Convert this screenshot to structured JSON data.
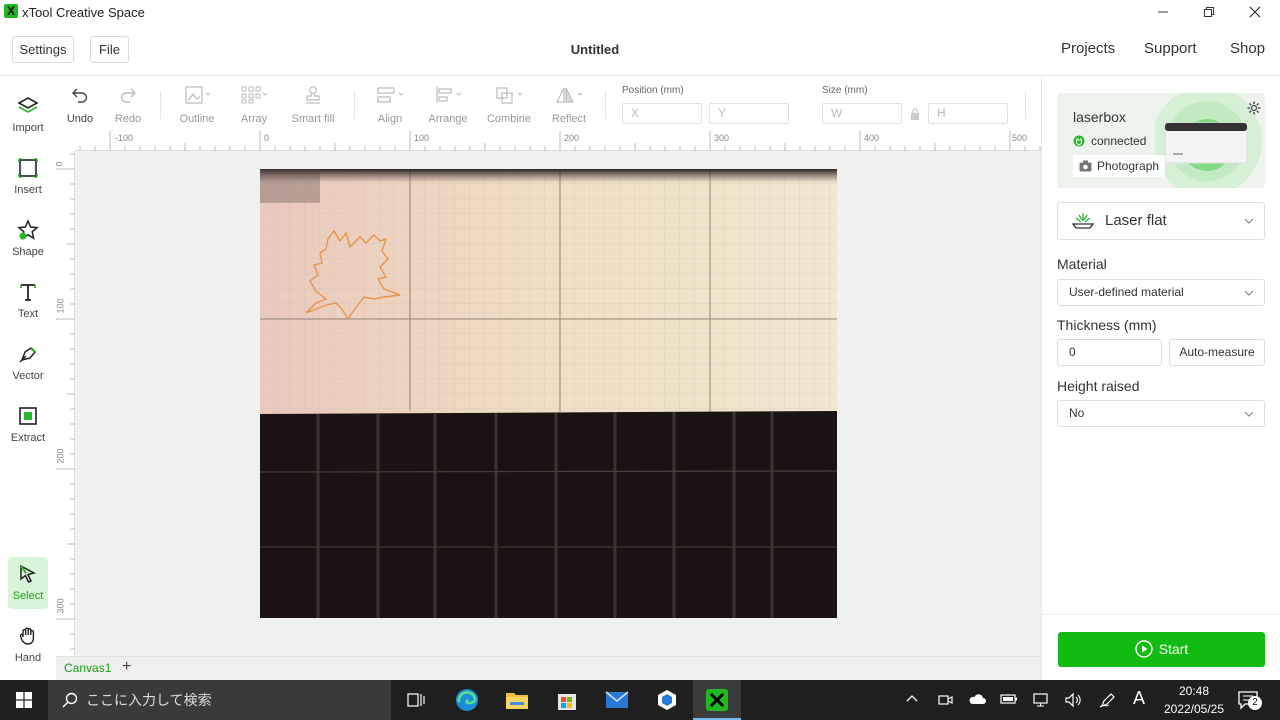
{
  "window": {
    "title": "xTool Creative Space",
    "logo_glyph": "X"
  },
  "menubar": {
    "settings_label": "Settings",
    "file_label": "File",
    "doc_title": "Untitled",
    "nav": [
      "Projects",
      "Support",
      "Shop"
    ]
  },
  "left_tools": [
    {
      "label": "Import",
      "icon": "layers-icon"
    },
    {
      "label": "Insert",
      "icon": "insert-icon"
    },
    {
      "label": "Shape",
      "icon": "star-icon"
    },
    {
      "label": "Text",
      "icon": "text-icon"
    },
    {
      "label": "Vector",
      "icon": "pen-icon"
    },
    {
      "label": "Extract",
      "icon": "extract-icon"
    },
    {
      "label": "Select",
      "icon": "cursor-icon",
      "active": true
    },
    {
      "label": "Hand",
      "icon": "hand-icon"
    }
  ],
  "toolbar": {
    "undo": "Undo",
    "redo": "Redo",
    "outline": "Outline",
    "array": "Array",
    "smart_fill": "Smart fill",
    "align": "Align",
    "arrange": "Arrange",
    "combine": "Combine",
    "reflect": "Reflect",
    "position_label": "Position (mm)",
    "size_label": "Size (mm)",
    "x_placeholder": "X",
    "y_placeholder": "Y",
    "w_placeholder": "W",
    "h_placeholder": "H"
  },
  "rulers": {
    "top_ticks": [
      "-100",
      "0",
      "100",
      "200",
      "300",
      "400",
      "500"
    ],
    "left_ticks": [
      "0",
      "100",
      "200",
      "300"
    ]
  },
  "canvas_tabs": {
    "active": "Canvas1",
    "add": "+"
  },
  "device": {
    "name": "laserbox",
    "status": "connected",
    "photograph_label": "Photograph"
  },
  "mode": {
    "label": "Laser flat"
  },
  "material": {
    "label": "Material",
    "value": "User-defined material"
  },
  "thickness": {
    "label": "Thickness (mm)",
    "value": "0",
    "auto_label": "Auto-measure"
  },
  "height_raised": {
    "label": "Height raised",
    "value": "No"
  },
  "start_label": "Start",
  "taskbar": {
    "search_placeholder": "ここに入力して検索",
    "time": "20:48",
    "date": "2022/05/25",
    "ime_label": "A",
    "notification_count": "2"
  },
  "colors": {
    "accent": "#11bb11",
    "select_bg": "#d9f5d9",
    "leaf_stroke": "#e8944a"
  }
}
